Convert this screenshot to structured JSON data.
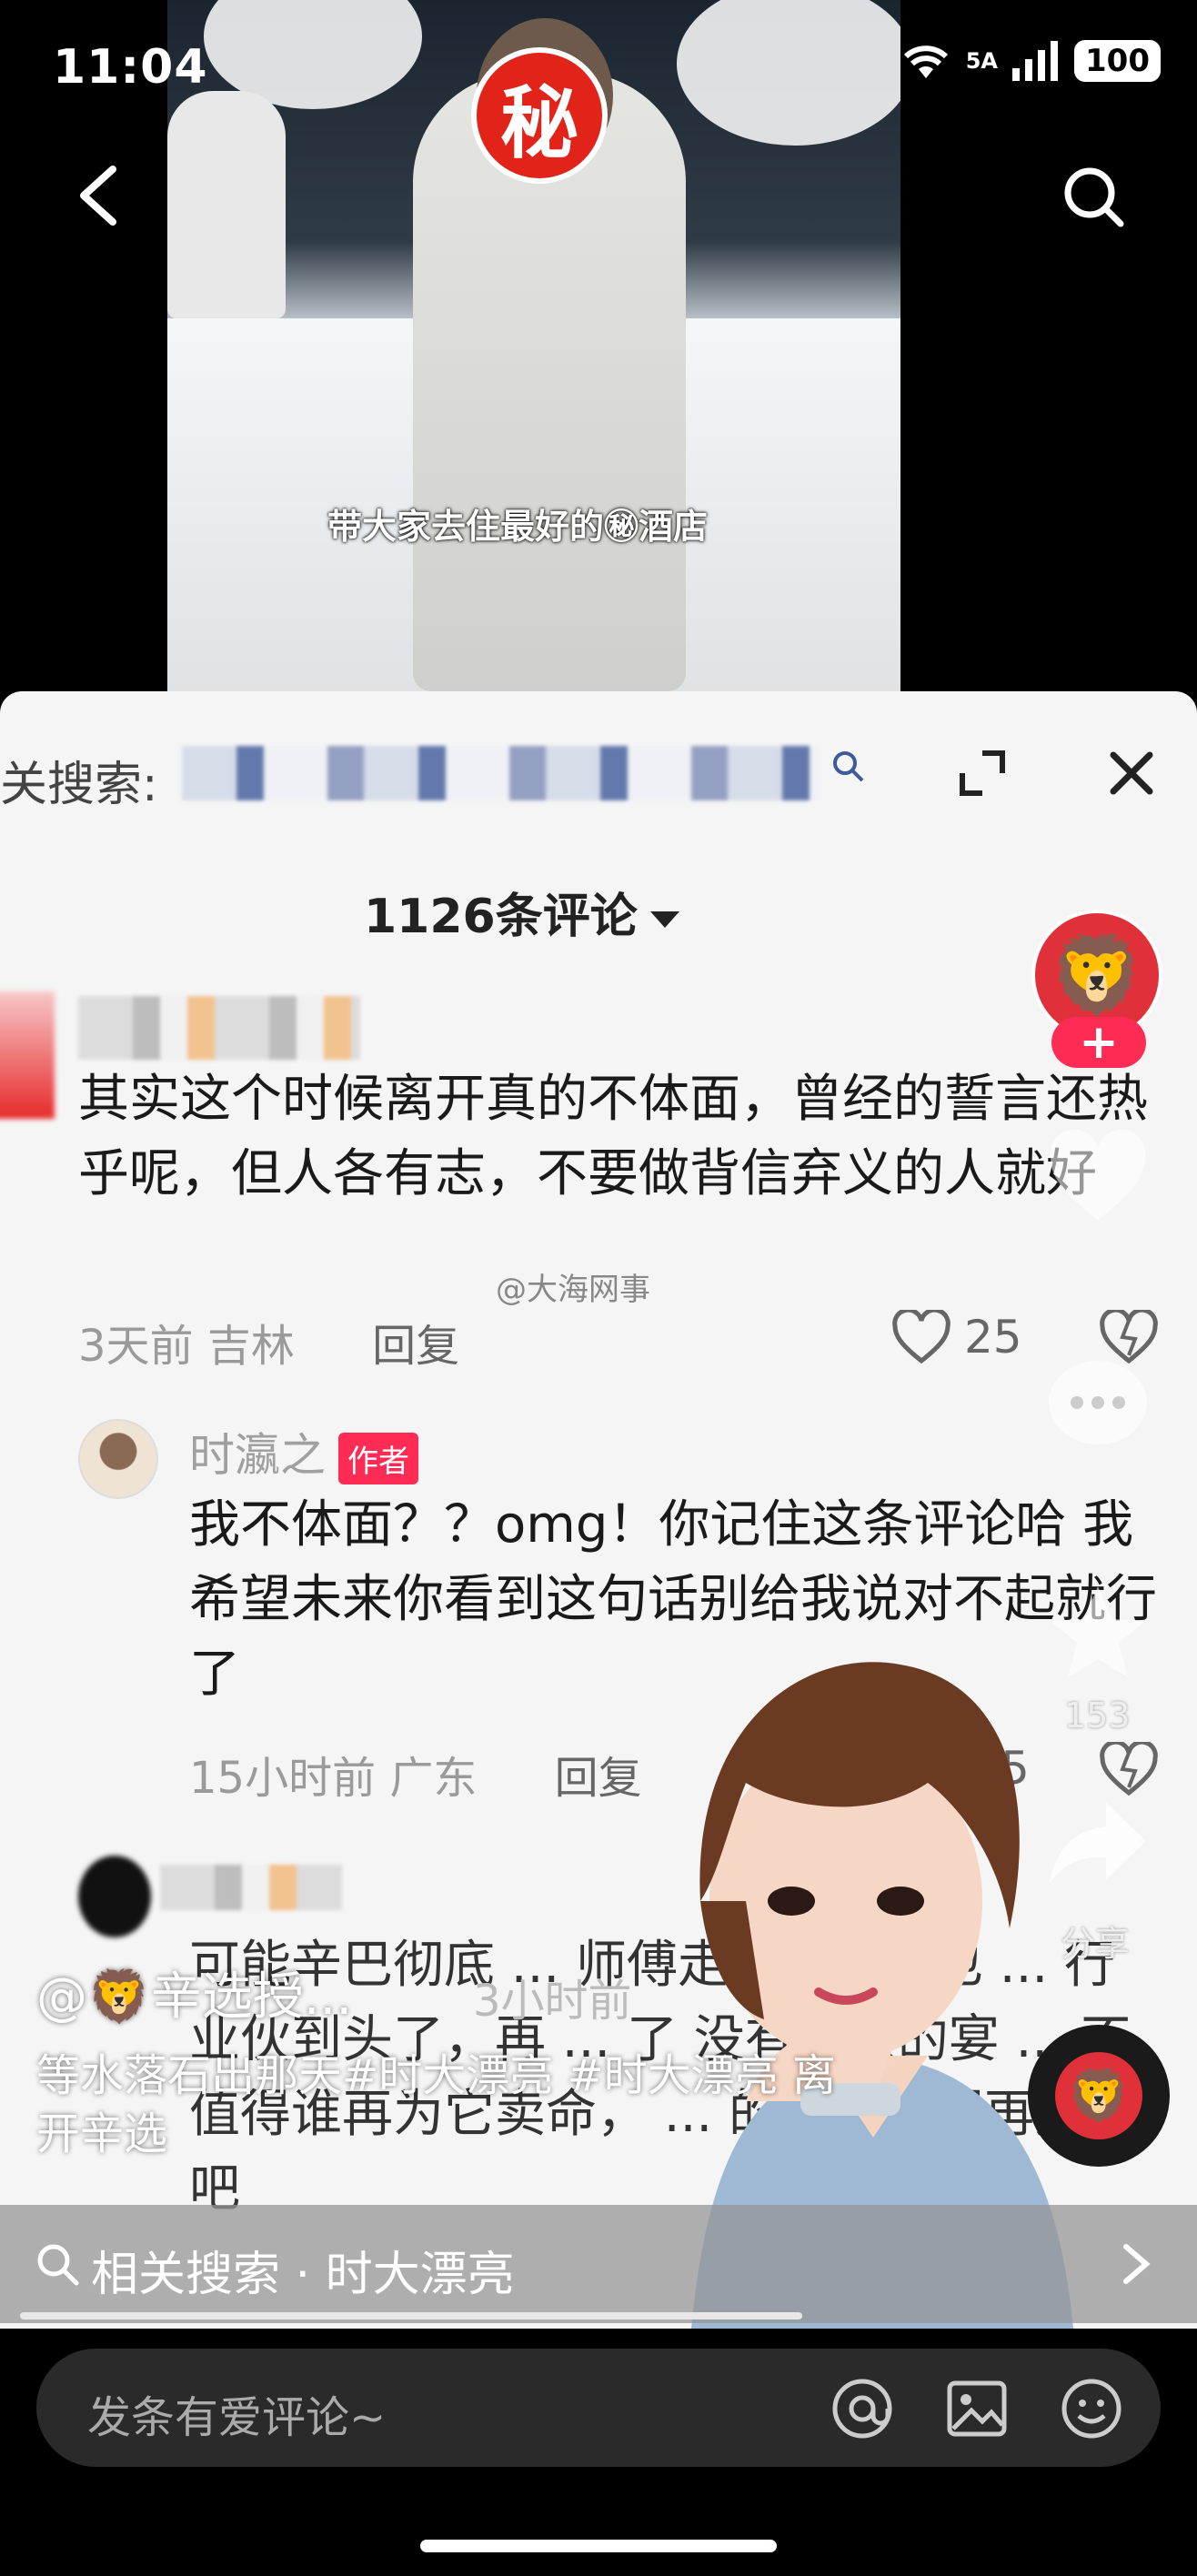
{
  "status_bar": {
    "time": "11:04",
    "network": "5A",
    "battery": "100"
  },
  "video": {
    "badge": "秘",
    "caption": "带大家去住最好的㊙酒店"
  },
  "sheet": {
    "related_prefix": "关搜索:",
    "comment_count": "1126条评论",
    "watermark": "@大海网事"
  },
  "comments": [
    {
      "text": "其实这个时候离开真的不体面，曾经的誓言还热乎呢，但人各有志，不要做背信弃义的人就好",
      "time": "3天前",
      "location": "吉林",
      "reply_label": "回复",
      "likes": "25"
    },
    {
      "author": "时瀛之",
      "tag": "作者",
      "text": "我不体面？？omg！你记住这条评论哈 我希望未来你看到这句话别给我说对不起就行了",
      "time": "15小时前",
      "location": "广东",
      "reply_label": "回复",
      "likes": "5"
    },
    {
      "text": "可能辛巴彻底 ... 师傅走了，徒弟也 ... 行业伙到头了，再 ... 了 没有不散的宴 ... 不值得谁再为它卖命， ... 的事，江湖再见吧",
      "time": "3小时前"
    }
  ],
  "rail": {
    "follow": "+",
    "stars": "153",
    "share": "分享"
  },
  "overlay": {
    "author": "@🦁辛选授...",
    "description": "等水落石出那天#时大漂亮 #时大漂亮 离开辛选"
  },
  "related_search": {
    "label": "相关搜索 · 时大漂亮"
  },
  "comment_input": {
    "placeholder": "发条有爱评论~"
  }
}
